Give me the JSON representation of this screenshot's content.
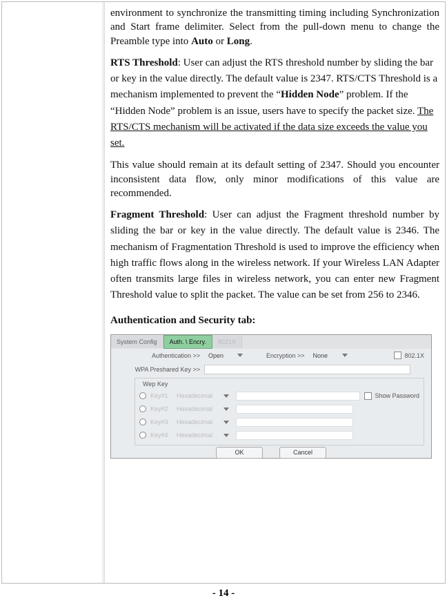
{
  "doc": {
    "p1_prefix": "environment to synchronize the transmitting timing including Synchronization and Start frame delimiter. Select from the pull-down menu to change the Preamble type into ",
    "p1_b1": "Auto",
    "p1_mid": " or ",
    "p1_b2": "Long",
    "p1_suffix": ".",
    "rts_label": "RTS Threshold",
    "rts_text1": ": User can adjust the RTS threshold number by sliding the bar or key in the value directly. The default value is 2347. RTS/CTS Threshold is a mechanism implemented to prevent the “",
    "rts_bold": "Hidden Node",
    "rts_text2": "” problem. If the “Hidden Node” problem is an issue, users have to specify the packet size. ",
    "rts_ul": "The RTS/CTS mechanism will be activated if the data size exceeds the value you set.",
    "rts_note": "This value should remain at its default setting of 2347. Should you encounter inconsistent data flow, only minor modifications of this value are recommended.",
    "frag_label": "Fragment Threshold",
    "frag_text": ": User can adjust the Fragment threshold number by sliding the bar or key in the value directly. The default value is 2346. The mechanism of Fragmentation Threshold is used to improve the efficiency when high traffic flows along in the wireless network. If your Wireless LAN Adapter often transmits large files in wireless network, you can enter new Fragment Threshold value to split the packet.   The value can be set from 256 to 2346.",
    "auth_heading": "Authentication and Security tab:"
  },
  "shot": {
    "tabs": {
      "sys": "System Config",
      "auth": "Auth. \\ Encry.",
      "dot1x": "8021X"
    },
    "row_auth_label": "Authentication >>",
    "row_auth_value": "Open",
    "row_enc_label": "Encryption >>",
    "row_enc_value": "None",
    "chk_8021x": "802.1X",
    "wpa_label": "WPA Preshared Key >>",
    "wep_title": "Wep Key",
    "wep": {
      "k1": "Key#1",
      "k2": "Key#2",
      "k3": "Key#3",
      "k4": "Key#4",
      "hex": "Hexadecimal"
    },
    "chk_showpw": "Show Password",
    "btn_ok": "OK",
    "btn_cancel": "Cancel"
  },
  "page_number": "- 14 -"
}
